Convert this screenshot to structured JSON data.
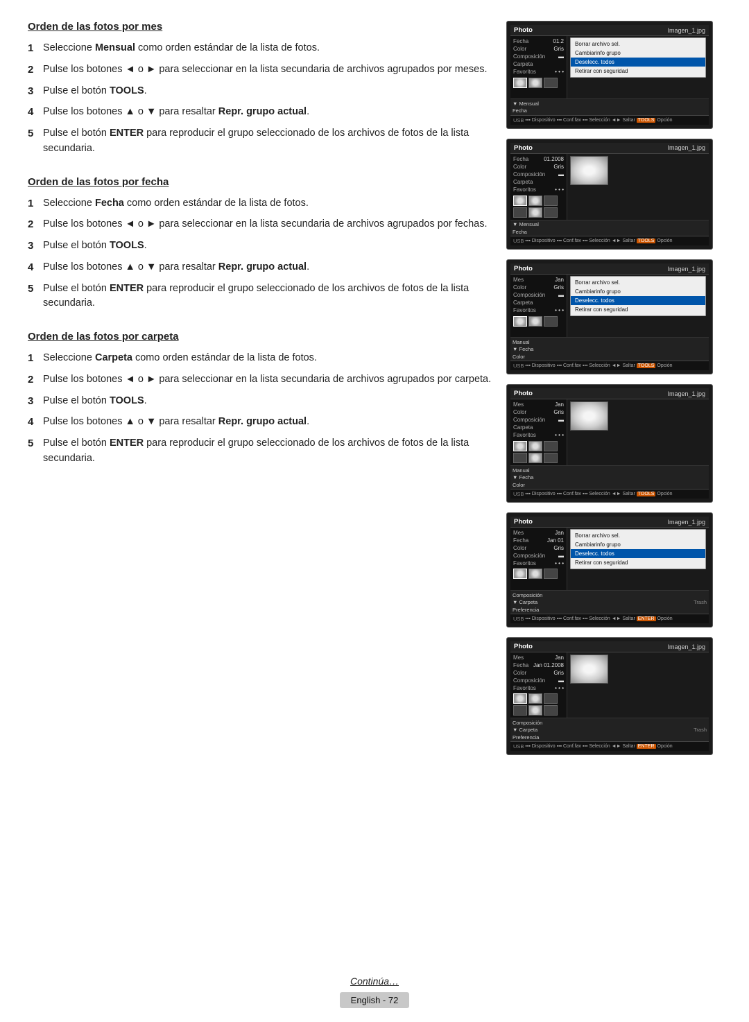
{
  "sections": [
    {
      "id": "por-mes",
      "title": "Orden de las fotos por mes",
      "steps": [
        {
          "num": "1",
          "text": "Seleccione ",
          "bold": "Mensual",
          "rest": " como orden estándar de la lista de fotos."
        },
        {
          "num": "2",
          "text": "Pulse los botones ◄ o ► para seleccionar en la lista secundaria de archivos agrupados por meses."
        },
        {
          "num": "3",
          "text": "Pulse el botón ",
          "bold": "TOOLS",
          "rest": "."
        },
        {
          "num": "4",
          "text": "Pulse los botones ▲ o ▼ para resaltar ",
          "bold": "Repr. grupo actual",
          "rest": "."
        },
        {
          "num": "5",
          "text": "Pulse el botón ",
          "bold": "ENTER",
          "rest": " para reproducir el grupo seleccionado de los archivos de fotos de la lista secundaria."
        }
      ],
      "screens": [
        {
          "id": "mes-screen-1",
          "filename": "Imagen_1.jpg",
          "label": "Photo",
          "meta": [
            {
              "label": "Fecha",
              "value": "01.2"
            },
            {
              "label": "Color",
              "value": "Gris"
            },
            {
              "label": "Composición",
              "value": ""
            },
            {
              "label": "Carpeta",
              "value": ""
            },
            {
              "label": "Favoritos",
              "value": "• • •"
            }
          ],
          "menuItems": [
            {
              "text": "Borrar archivo sel.",
              "highlighted": false
            },
            {
              "text": "Cambiarinfo grupo",
              "highlighted": false
            },
            {
              "text": "Deselecc. todos",
              "highlighted": true
            },
            {
              "text": "Retirar con seguridad",
              "highlighted": false
            }
          ],
          "prefsLabel": "Mensual",
          "prefsLabel2": "Fecha"
        },
        {
          "id": "mes-screen-2",
          "filename": "Imagen_1.jpg",
          "label": "Photo",
          "meta": [
            {
              "label": "Fecha",
              "value": "01.2008"
            },
            {
              "label": "Color",
              "value": "Gris"
            },
            {
              "label": "Composición",
              "value": ""
            },
            {
              "label": "Carpeta",
              "value": ""
            },
            {
              "label": "Favoritos",
              "value": "• • •"
            }
          ],
          "menuItems": [],
          "prefsLabel": "Mensual",
          "prefsLabel2": "Fecha"
        }
      ]
    },
    {
      "id": "por-fecha",
      "title": "Orden de las fotos por fecha",
      "steps": [
        {
          "num": "1",
          "text": "Seleccione ",
          "bold": "Fecha",
          "rest": " como orden estándar de la lista de fotos."
        },
        {
          "num": "2",
          "text": "Pulse los botones ◄ o ► para seleccionar en la lista secundaria de archivos agrupados por fechas."
        },
        {
          "num": "3",
          "text": "Pulse el botón ",
          "bold": "TOOLS",
          "rest": "."
        },
        {
          "num": "4",
          "text": "Pulse los botones ▲ o ▼ para resaltar ",
          "bold": "Repr. grupo actual",
          "rest": "."
        },
        {
          "num": "5",
          "text": "Pulse el botón ",
          "bold": "ENTER",
          "rest": " para reproducir el grupo seleccionado de los archivos de fotos de la lista secundaria."
        }
      ],
      "screens": [
        {
          "id": "fecha-screen-1",
          "filename": "Imagen_1.jpg",
          "label": "Photo",
          "meta": [
            {
              "label": "Mes",
              "value": "Jan"
            },
            {
              "label": "Color",
              "value": "Gris"
            },
            {
              "label": "Composición",
              "value": ""
            },
            {
              "label": "Carpeta",
              "value": ""
            },
            {
              "label": "Favoritos",
              "value": "• • •"
            }
          ],
          "menuItems": [
            {
              "text": "Borrar archivo sel.",
              "highlighted": false
            },
            {
              "text": "Cambiarinfo grupo",
              "highlighted": false
            },
            {
              "text": "Deselecc. todos",
              "highlighted": true
            },
            {
              "text": "Retirar con seguridad",
              "highlighted": false
            }
          ],
          "prefsLabel": "Manual",
          "prefsLabel2": "Fecha",
          "prefsLabel3": "Color"
        },
        {
          "id": "fecha-screen-2",
          "filename": "Imagen_1.jpg",
          "label": "Photo",
          "meta": [
            {
              "label": "Mes",
              "value": "Jan"
            },
            {
              "label": "Color",
              "value": "Gris"
            },
            {
              "label": "Composición",
              "value": ""
            },
            {
              "label": "Carpeta",
              "value": ""
            },
            {
              "label": "Favoritos",
              "value": "• • •"
            }
          ],
          "menuItems": [],
          "prefsLabel": "Manual",
          "prefsLabel2": "Fecha",
          "prefsLabel3": "Color"
        }
      ]
    },
    {
      "id": "por-carpeta",
      "title": "Orden de las fotos por carpeta",
      "steps": [
        {
          "num": "1",
          "text": "Seleccione ",
          "bold": "Carpeta",
          "rest": " como orden estándar de la lista de fotos."
        },
        {
          "num": "2",
          "text": "Pulse los botones ◄ o ► para seleccionar en la lista secundaria de archivos agrupados por carpeta."
        },
        {
          "num": "3",
          "text": "Pulse el botón ",
          "bold": "TOOLS",
          "rest": "."
        },
        {
          "num": "4",
          "text": "Pulse los botones ▲ o ▼ para resaltar ",
          "bold": "Repr. grupo actual",
          "rest": "."
        },
        {
          "num": "5",
          "text": "Pulse el botón ",
          "bold": "ENTER",
          "rest": " para reproducir el grupo seleccionado de los archivos de fotos de la lista secundaria."
        }
      ],
      "screens": [
        {
          "id": "carpeta-screen-1",
          "filename": "Imagen_1.jpg",
          "label": "Photo",
          "meta": [
            {
              "label": "Mes",
              "value": "Jan"
            },
            {
              "label": "Fecha",
              "value": "Jan 01"
            },
            {
              "label": "Color",
              "value": "Gris"
            },
            {
              "label": "Composición",
              "value": ""
            },
            {
              "label": "Favoritos",
              "value": "• • •"
            }
          ],
          "menuItems": [
            {
              "text": "Borrar archivo sel.",
              "highlighted": false
            },
            {
              "text": "Cambiarinfo grupo",
              "highlighted": false
            },
            {
              "text": "Deselecc. todos",
              "highlighted": true
            },
            {
              "text": "Retirar con seguridad",
              "highlighted": false
            }
          ],
          "prefsLabel": "Composición",
          "prefsLabel2": "Carpeta",
          "prefsLabel3": "Preferencia",
          "rightLabel": "Trash"
        },
        {
          "id": "carpeta-screen-2",
          "filename": "Imagen_1.jpg",
          "label": "Photo",
          "meta": [
            {
              "label": "Mes",
              "value": "Jan"
            },
            {
              "label": "Fecha",
              "value": "Jan 01.2008"
            },
            {
              "label": "Color",
              "value": "Gris"
            },
            {
              "label": "Composición",
              "value": ""
            },
            {
              "label": "Favoritos",
              "value": "• • •"
            }
          ],
          "menuItems": [],
          "prefsLabel": "Composición",
          "prefsLabel2": "Carpeta",
          "prefsLabel3": "Preferencia",
          "rightLabel": "Trash"
        }
      ]
    }
  ],
  "footer": {
    "continue": "Continúa…",
    "badge": "English - 72"
  }
}
